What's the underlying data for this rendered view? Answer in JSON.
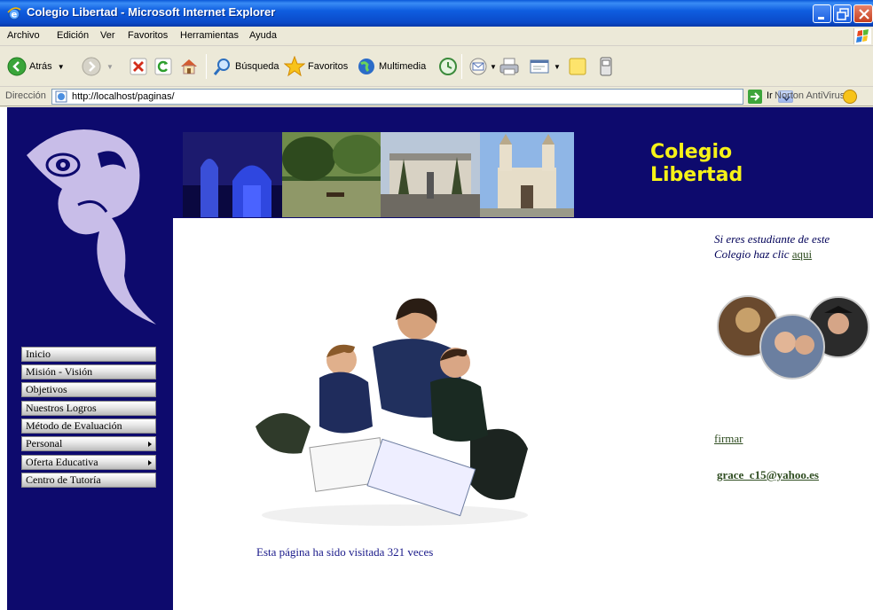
{
  "window": {
    "title": "Colegio Libertad - Microsoft Internet Explorer"
  },
  "menu": [
    "Archivo",
    "Edición",
    "Ver",
    "Favoritos",
    "Herramientas",
    "Ayuda"
  ],
  "toolbar": {
    "back": "Atrás",
    "search": "Búsqueda",
    "favorites": "Favoritos",
    "media": "Multimedia"
  },
  "address": {
    "label": "Dirección",
    "url": "http://localhost/paginas/",
    "go": "Ir",
    "norton": "Norton AntiVirus"
  },
  "site": {
    "title_line1": "Colegio",
    "title_line2": "Libertad",
    "nav": [
      {
        "label": "Inicio",
        "submenu": false
      },
      {
        "label": "Misión - Visión",
        "submenu": false
      },
      {
        "label": "Objetivos",
        "submenu": false
      },
      {
        "label": "Nuestros Logros",
        "submenu": false
      },
      {
        "label": "Método de Evaluación",
        "submenu": false
      },
      {
        "label": "Personal",
        "submenu": true
      },
      {
        "label": "Oferta Educativa",
        "submenu": true
      },
      {
        "label": "Centro de Tutoría",
        "submenu": false
      }
    ],
    "student_line1": "Si eres estudiante de este",
    "student_line2": "Colegio haz clic",
    "student_link": "aqui",
    "sign_link": "firmar",
    "email": "grace_c15@yahoo.es",
    "visits": "Esta página ha sido visitada 321 veces"
  },
  "colors": {
    "sidebar": "#0d0a6d",
    "title_yellow": "#f6f218",
    "xp_blue": "#0a49c8"
  }
}
